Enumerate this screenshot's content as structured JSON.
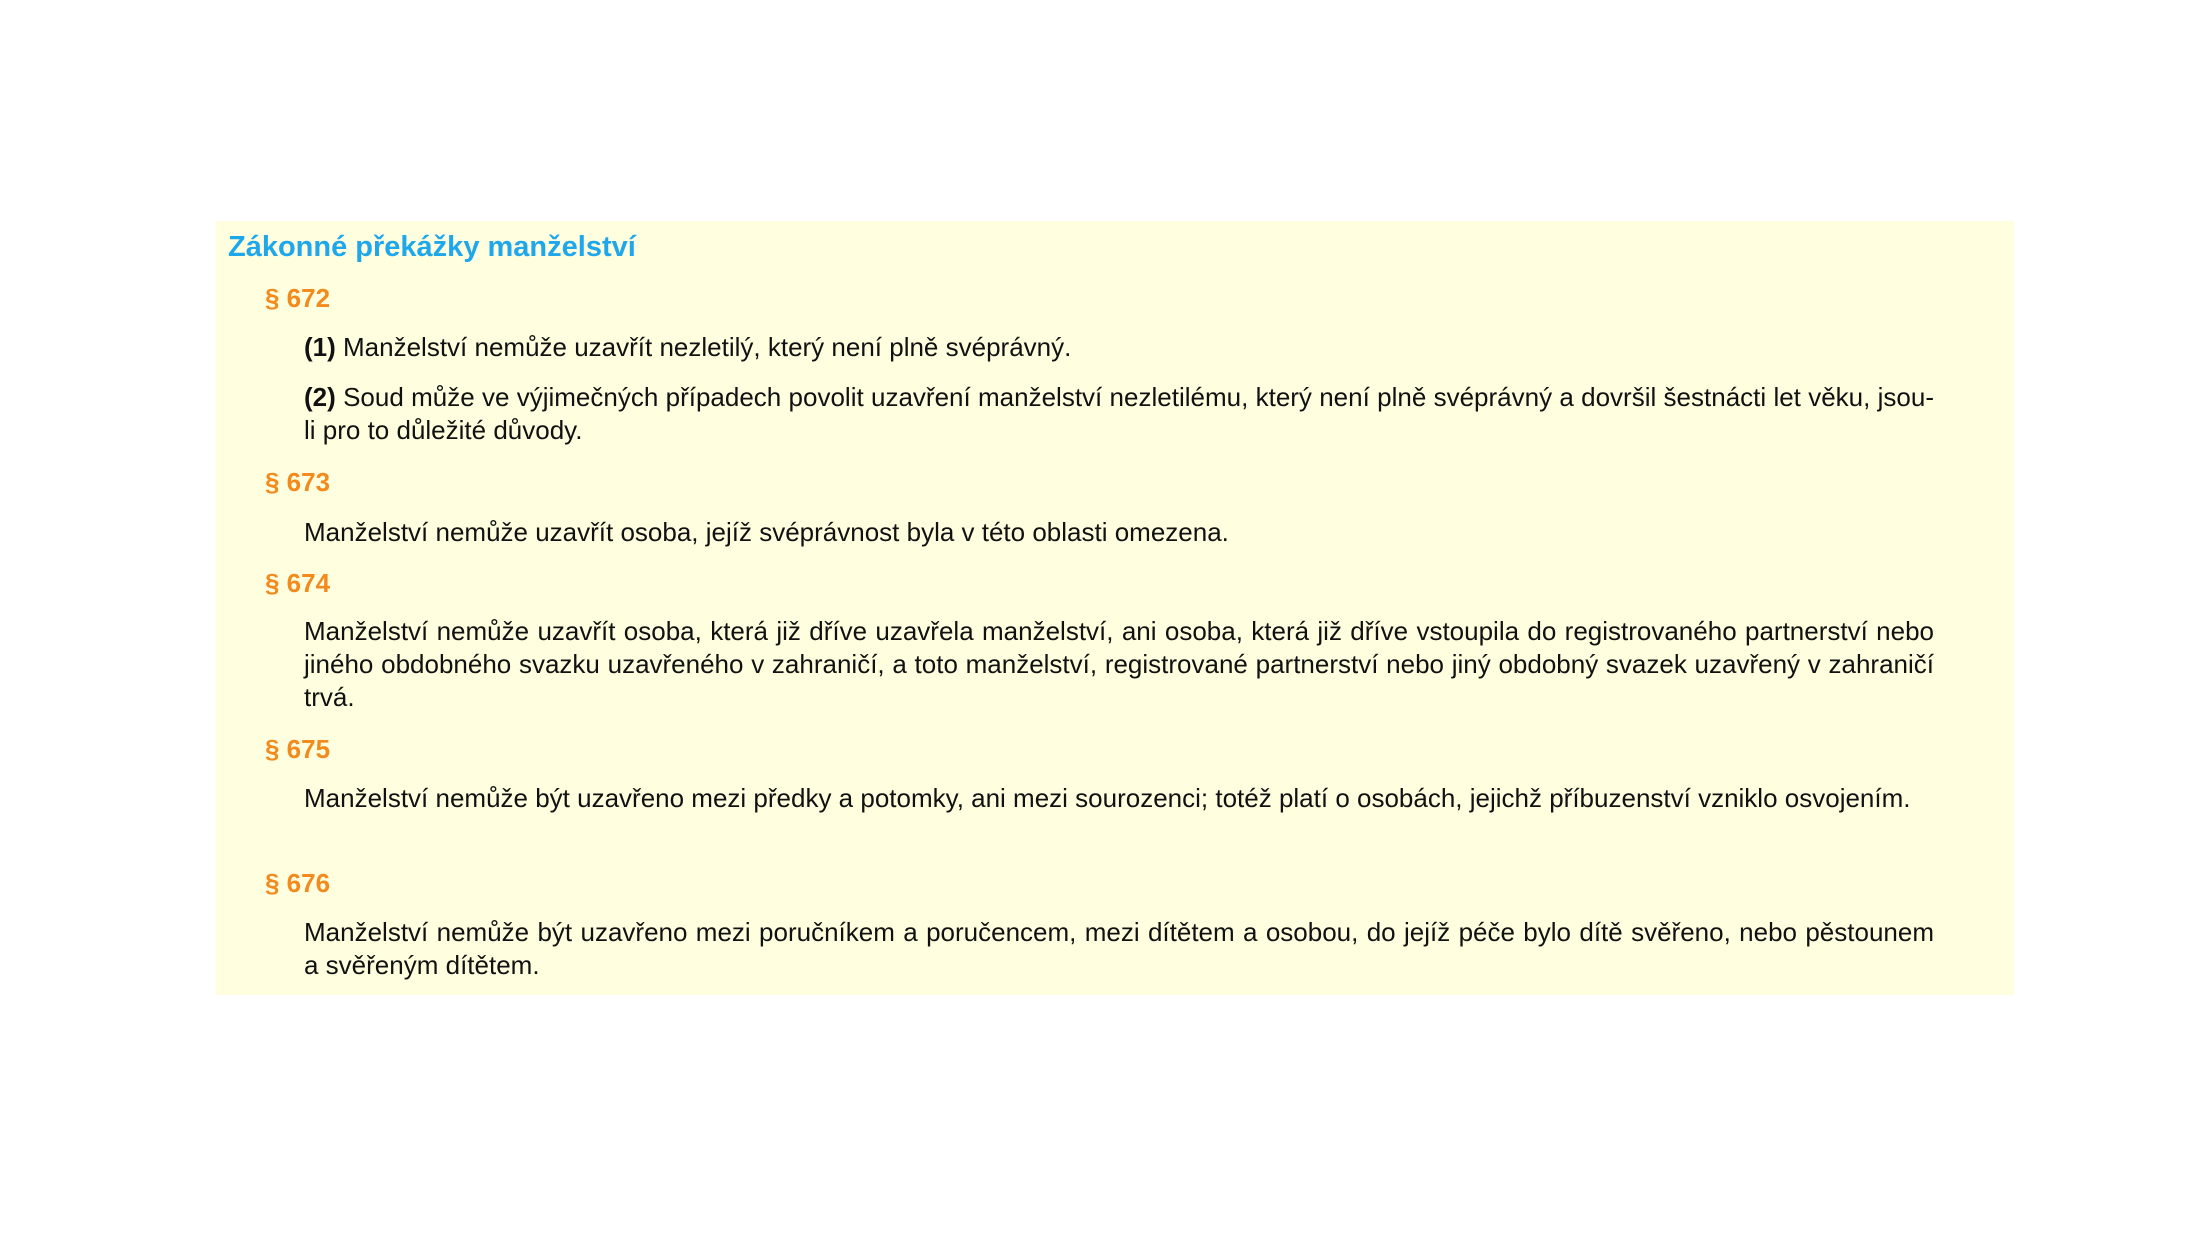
{
  "document": {
    "title": "Zákonné překážky manželství",
    "sections": [
      {
        "heading": "§ 672",
        "paragraphs": [
          {
            "number": "(1)",
            "text": " Manželství nemůže uzavřít nezletilý, který není plně svéprávný."
          },
          {
            "number": "(2)",
            "text": " Soud může ve výjimečných případech povolit uzavření manželství nezletilému, který není plně svéprávný a dovršil šestnácti let věku, jsou-li pro to důležité důvody."
          }
        ]
      },
      {
        "heading": "§ 673",
        "paragraphs": [
          {
            "text": "Manželství nemůže uzavřít osoba, jejíž svéprávnost byla v této oblasti omezena."
          }
        ]
      },
      {
        "heading": "§ 674",
        "paragraphs": [
          {
            "text": "Manželství nemůže uzavřít osoba, která již dříve uzavřela manželství, ani osoba, která již dříve vstoupila do registrovaného partnerství nebo jiného obdobného svazku uzavřeného v zahraničí, a toto manželství, registrované partnerství nebo jiný obdobný svazek uzavřený v zahraničí trvá."
          }
        ]
      },
      {
        "heading": "§ 675",
        "paragraphs": [
          {
            "text": "Manželství nemůže být uzavřeno mezi předky a potomky, ani mezi sourozenci; totéž platí o osobách, jejichž příbuzenství vzniklo osvojením."
          }
        ]
      },
      {
        "heading": "§ 676",
        "paragraphs": [
          {
            "text": "Manželství nemůže být uzavřeno mezi poručníkem a poručencem, mezi dítětem a osobou, do jejíž péče bylo dítě svěřeno, nebo pěstounem a svěřeným dítětem."
          }
        ]
      }
    ]
  },
  "colors": {
    "background": "#ffffe0",
    "title": "#1ea7ea",
    "section_heading": "#f28a1e",
    "body_text": "#111111"
  }
}
